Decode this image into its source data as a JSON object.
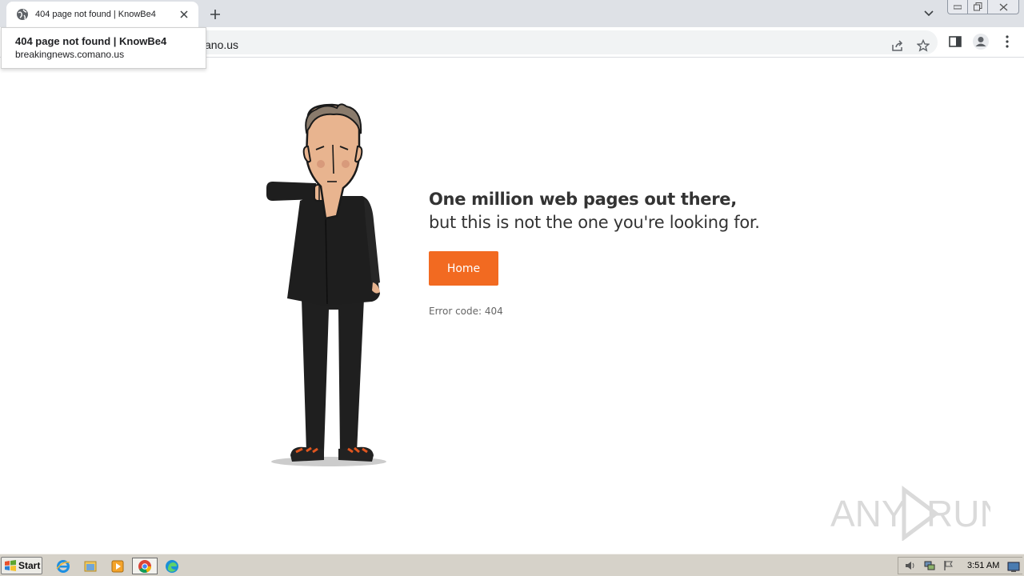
{
  "browser": {
    "tab_title": "404 page not found | KnowBe4",
    "url_visible": "ano.us",
    "hovercard": {
      "title": "404 page not found | KnowBe4",
      "url": "breakingnews.comano.us"
    },
    "icons": [
      "globe-icon",
      "close-icon",
      "plus-icon",
      "chevron-down-icon",
      "share-icon",
      "star-icon",
      "side-panel-icon",
      "profile-icon",
      "menu-icon"
    ]
  },
  "page": {
    "headline_line1": "One million web pages out there,",
    "headline_line2": "but this is not the one you're looking for.",
    "home_label": "Home",
    "error_code": "Error code: 404",
    "accent_color": "#f26a21"
  },
  "taskbar": {
    "start_label": "Start",
    "clock": "3:51 AM",
    "apps": [
      "internet-explorer-icon",
      "folder-icon",
      "media-player-icon",
      "chrome-icon",
      "edge-icon"
    ]
  }
}
